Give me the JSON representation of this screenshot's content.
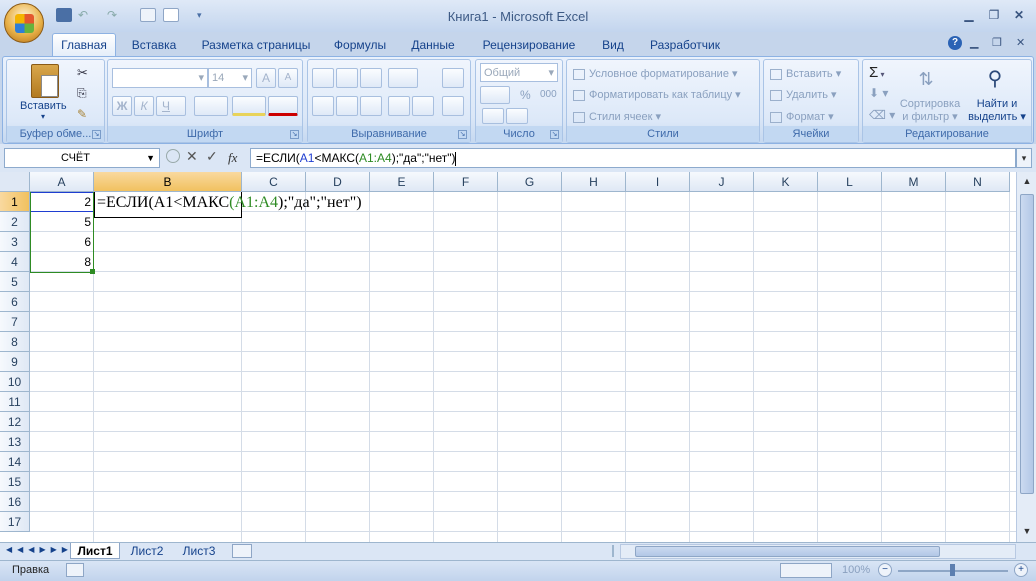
{
  "window": {
    "title": "Книга1 - Microsoft Excel"
  },
  "tabs": [
    "Главная",
    "Вставка",
    "Разметка страницы",
    "Формулы",
    "Данные",
    "Рецензирование",
    "Вид",
    "Разработчик"
  ],
  "ribbon": {
    "clipboard": {
      "label": "Буфер обме...",
      "paste": "Вставить"
    },
    "font": {
      "label": "Шрифт",
      "size": "14",
      "bold": "Ж",
      "italic": "К",
      "underline": "Ч",
      "grow": "A",
      "shrink": "A"
    },
    "alignment": {
      "label": "Выравнивание"
    },
    "number": {
      "label": "Число",
      "format": "Общий",
      "percent": "%",
      "thousands": "000"
    },
    "styles": {
      "label": "Стили",
      "conditional": "Условное форматирование",
      "as_table": "Форматировать как таблицу",
      "cell_styles": "Стили ячеек"
    },
    "cells": {
      "label": "Ячейки",
      "insert": "Вставить",
      "delete": "Удалить",
      "format": "Формат"
    },
    "editing": {
      "label": "Редактирование",
      "sum": "Σ",
      "sort_line1": "Сортировка",
      "sort_line2": "и фильтр",
      "find_line1": "Найти и",
      "find_line2": "выделить"
    }
  },
  "formula_bar": {
    "name_box": "СЧЁТ",
    "fx": "fx",
    "formula_parts": [
      "=ЕСЛИ(",
      "A1",
      "<МАКС(",
      "A1:A4",
      ");\"да\";\"нет\")"
    ]
  },
  "grid": {
    "columns": [
      "A",
      "B",
      "C",
      "D",
      "E",
      "F",
      "G",
      "H",
      "I",
      "J",
      "K",
      "L",
      "M",
      "N"
    ],
    "rows": [
      "1",
      "2",
      "3",
      "4",
      "5",
      "6",
      "7",
      "8",
      "9",
      "10",
      "11",
      "12",
      "13",
      "14",
      "15",
      "16",
      "17"
    ],
    "cells": {
      "A1": "2",
      "A2": "5",
      "A3": "6",
      "A4": "8"
    },
    "editing_cell_parts": [
      "=ЕСЛИ(A1<МАКС",
      "(",
      "A1:A4",
      ");\"да\";\"нет\")"
    ]
  },
  "sheets": [
    "Лист1",
    "Лист2",
    "Лист3"
  ],
  "status": {
    "mode": "Правка",
    "zoom": "100%"
  },
  "colors": {
    "ref_blue": "#1f3ed1",
    "ref_green": "#2e8b23"
  }
}
